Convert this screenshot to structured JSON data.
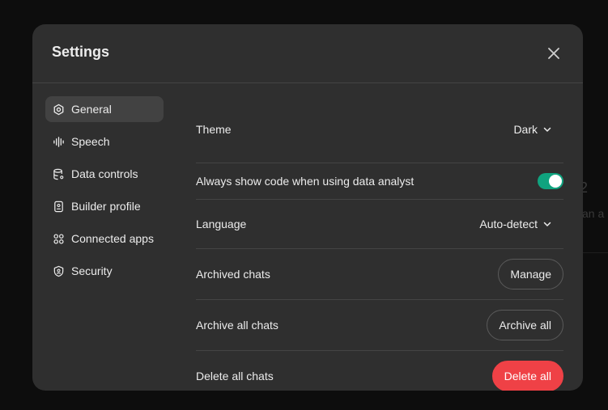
{
  "colors": {
    "backdrop": "#0d0d0d",
    "modal_bg": "#2f2f2f",
    "active_item_bg": "#424242",
    "divider": "#444444",
    "toggle_on": "#10a37f",
    "danger": "#ef4146"
  },
  "modal": {
    "title": "Settings",
    "close_icon": "close-icon"
  },
  "sidebar": {
    "items": [
      {
        "label": "General",
        "icon": "gear-icon",
        "active": true
      },
      {
        "label": "Speech",
        "icon": "waveform-icon",
        "active": false
      },
      {
        "label": "Data controls",
        "icon": "database-icon",
        "active": false
      },
      {
        "label": "Builder profile",
        "icon": "id-badge-icon",
        "active": false
      },
      {
        "label": "Connected apps",
        "icon": "apps-grid-icon",
        "active": false
      },
      {
        "label": "Security",
        "icon": "shield-icon",
        "active": false
      }
    ]
  },
  "general": {
    "theme": {
      "label": "Theme",
      "value": "Dark"
    },
    "code_toggle": {
      "label": "Always show code when using data analyst",
      "enabled": true
    },
    "language": {
      "label": "Language",
      "value": "Auto-detect"
    },
    "archived_chats": {
      "label": "Archived chats",
      "button": "Manage"
    },
    "archive_all": {
      "label": "Archive all chats",
      "button": "Archive all"
    },
    "delete_all": {
      "label": "Delete all chats",
      "button": "Delete all"
    }
  },
  "background": {
    "fragment_1": "2",
    "fragment_2": "an a"
  }
}
